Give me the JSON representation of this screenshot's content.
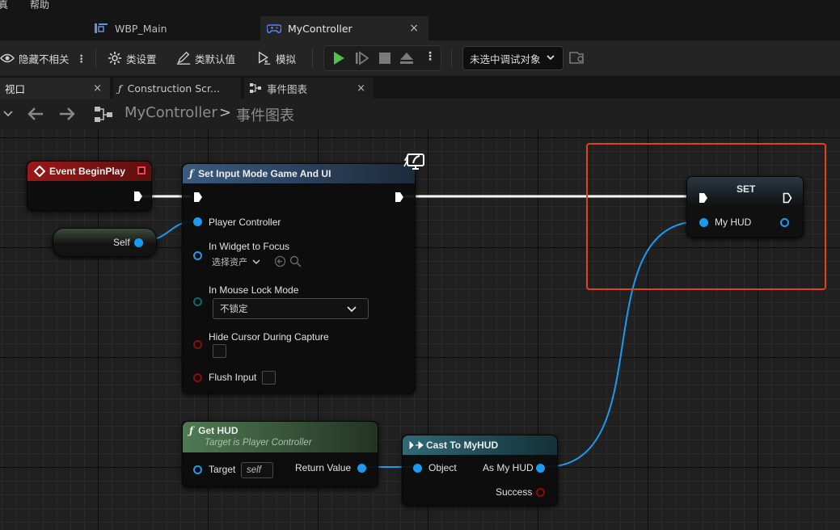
{
  "menu": [
    "真",
    "帮助"
  ],
  "doc_tabs": [
    {
      "label": "WBP_Main",
      "icon": "widget-blueprint-icon"
    },
    {
      "label": "MyController",
      "icon": "gamepad-icon",
      "close": "×"
    }
  ],
  "toolbar": {
    "hide_unrelated": "隐藏不相关",
    "class_settings": "类设置",
    "class_defaults": "类默认值",
    "simulate": "模拟",
    "debug_target": "未选中调试对象"
  },
  "panel_tabs": [
    {
      "label": "视口",
      "close": "×"
    },
    {
      "label": "Construction Scr...",
      "icon": "function-icon"
    },
    {
      "label": "事件图表",
      "icon": "graph-icon",
      "close": "×"
    }
  ],
  "breadcrumb": {
    "root": "MyController",
    "sep": ">",
    "current": "事件图表"
  },
  "nodes": {
    "begin_play": {
      "title": "Event BeginPlay"
    },
    "self": {
      "label": "Self"
    },
    "set_input_mode": {
      "title": "Set Input Mode Game And UI",
      "player_controller": "Player Controller",
      "widget_to_focus": "In Widget to Focus",
      "asset_picker": "选择资产",
      "mouse_lock_mode": "In Mouse Lock Mode",
      "mouse_lock_value": "不锁定",
      "hide_cursor": "Hide Cursor During Capture",
      "flush_input": "Flush Input"
    },
    "set_node": {
      "title": "SET",
      "my_hud": "My HUD"
    },
    "get_hud": {
      "title": "Get HUD",
      "subtitle": "Target is Player Controller",
      "target": "Target",
      "target_default": "self",
      "return_value": "Return Value"
    },
    "cast": {
      "title": "Cast To MyHUD",
      "object": "Object",
      "as_my_hud": "As My HUD",
      "success": "Success"
    }
  },
  "colors": {
    "exec_wire": "#ffffff",
    "object_wire": "#1b9bf0",
    "selection_box": "#e0431c",
    "event_header": "#8a1414",
    "function_header": "#304a68",
    "pure_header": "#3d5c3f",
    "cast_header": "#2c5660",
    "play": "#4ec14e"
  }
}
